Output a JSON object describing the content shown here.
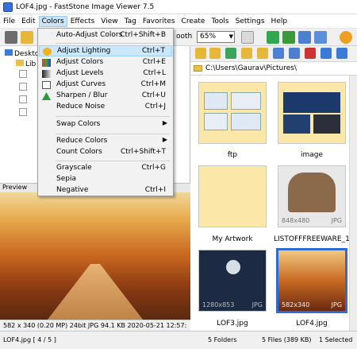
{
  "window": {
    "title": "LOF4.jpg - FastStone Image Viewer 7.5"
  },
  "menubar": {
    "items": [
      "File",
      "Edit",
      "Colors",
      "Effects",
      "View",
      "Tag",
      "Favorites",
      "Create",
      "Tools",
      "Settings",
      "Help"
    ]
  },
  "toolbar": {
    "zoom_label": "ooth",
    "zoom_value": "65%"
  },
  "colors_menu": {
    "items": [
      {
        "label": "Auto-Adjust Colors",
        "shortcut": "Ctrl+Shift+B"
      },
      {
        "label": "Adjust Lighting",
        "shortcut": "Ctrl+T"
      },
      {
        "label": "Adjust Colors",
        "shortcut": "Ctrl+E"
      },
      {
        "label": "Adjust Levels",
        "shortcut": "Ctrl+L"
      },
      {
        "label": "Adjust Curves",
        "shortcut": "Ctrl+M"
      },
      {
        "label": "Sharpen / Blur",
        "shortcut": "Ctrl+U"
      },
      {
        "label": "Reduce Noise",
        "shortcut": "Ctrl+J"
      },
      {
        "label": "Swap Colors",
        "shortcut": ""
      },
      {
        "label": "Reduce Colors",
        "shortcut": ""
      },
      {
        "label": "Count Colors",
        "shortcut": "Ctrl+Shift+T"
      },
      {
        "label": "Grayscale",
        "shortcut": "Ctrl+G"
      },
      {
        "label": "Sepia",
        "shortcut": ""
      },
      {
        "label": "Negative",
        "shortcut": "Ctrl+I"
      }
    ],
    "highlighted": "Adjust Lighting"
  },
  "tree": {
    "desktop": "Deskto",
    "libraries": "Lib"
  },
  "preview": {
    "label": "Preview",
    "info": "582 x 340 (0.20 MP)  24bit  JPG  94.1 KB  2020-05-21 12:57:"
  },
  "browser": {
    "path": "C:\\Users\\Gaurav\\Pictures\\",
    "thumbnails": [
      {
        "name": "ftp",
        "dims": "",
        "type": ""
      },
      {
        "name": "image",
        "dims": "",
        "type": ""
      },
      {
        "name": "My Artwork",
        "dims": "",
        "type": ""
      },
      {
        "name": "LISTOFFFREEWARE_1....",
        "dims": "848x480",
        "type": "JPG"
      },
      {
        "name": "LOF3.jpg",
        "dims": "1280x853",
        "type": "JPG"
      },
      {
        "name": "LOF4.jpg",
        "dims": "582x340",
        "type": "JPG"
      }
    ]
  },
  "statusbar": {
    "file": "LOF4.jpg [ 4 / 5 ]",
    "folders": "5 Folders",
    "files": "5 Files (389 KB)",
    "selected": "1 Selected"
  },
  "colors": {
    "accent": "#2d6bd0",
    "menu_highlight": "#cce8ff",
    "folder": "#fbe7a7"
  }
}
